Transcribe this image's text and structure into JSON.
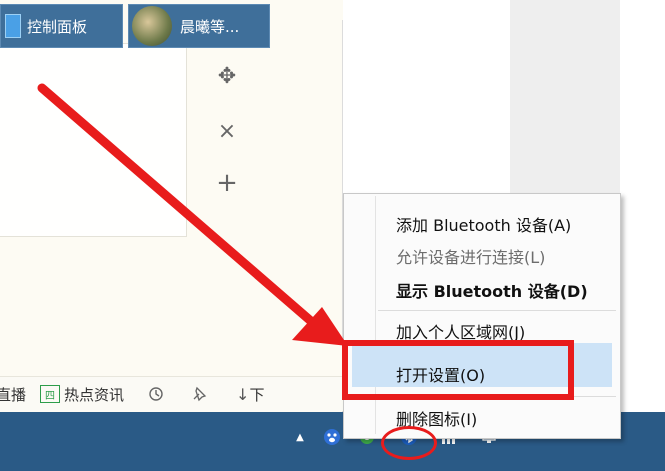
{
  "toolbar": {
    "item1": "直播",
    "hot_icon": "四",
    "item2": "热点资讯",
    "item3_icon": "history-icon",
    "item4_icon": "pin-icon",
    "item5": "下"
  },
  "side_icons": {
    "move": "✥",
    "close": "×",
    "add": "+"
  },
  "context_menu": {
    "items": [
      "添加 Bluetooth 设备(A)",
      "允许设备进行连接(L)",
      "显示 Bluetooth 设备(D)",
      "加入个人区域网(J)",
      "打开设置(O)",
      "删除图标(I)"
    ]
  },
  "taskbar": {
    "control_panel": "控制面板",
    "app2": "晨曦等..."
  },
  "tray": {
    "chevron": "▲",
    "icons": [
      "baidu-paw-icon",
      "green-app-icon",
      "bluetooth-icon",
      "signal-icon",
      "network-icon"
    ]
  },
  "colors": {
    "highlight": "#cde3f7",
    "annotation_red": "#e81c1c",
    "taskbar": "#2a5a86"
  }
}
